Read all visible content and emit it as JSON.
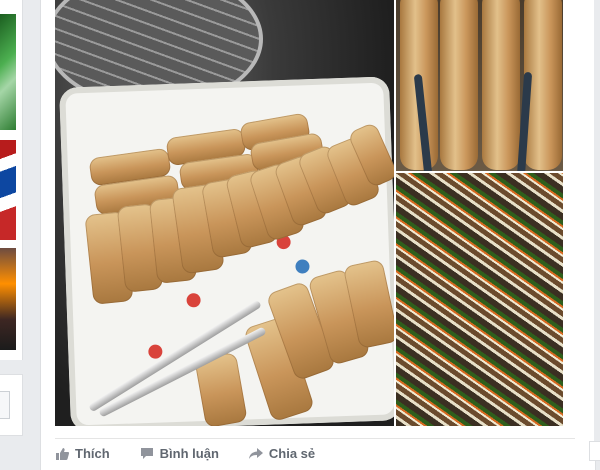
{
  "post": {
    "photos": [
      {
        "name": "spring-rolls-tray",
        "description_icon": "photo"
      },
      {
        "name": "spring-rolls-tongs",
        "description_icon": "photo"
      },
      {
        "name": "filling-mix",
        "description_icon": "photo"
      }
    ],
    "actions": {
      "like_label": "Thích",
      "comment_label": "Bình luận",
      "share_label": "Chia sẻ"
    }
  },
  "colors": {
    "page_bg": "#e9ebee",
    "card_bg": "#ffffff",
    "action_text": "#606770"
  },
  "icons": {
    "like": "thumbs-up-icon",
    "comment": "comment-icon",
    "share": "share-arrow-icon"
  }
}
